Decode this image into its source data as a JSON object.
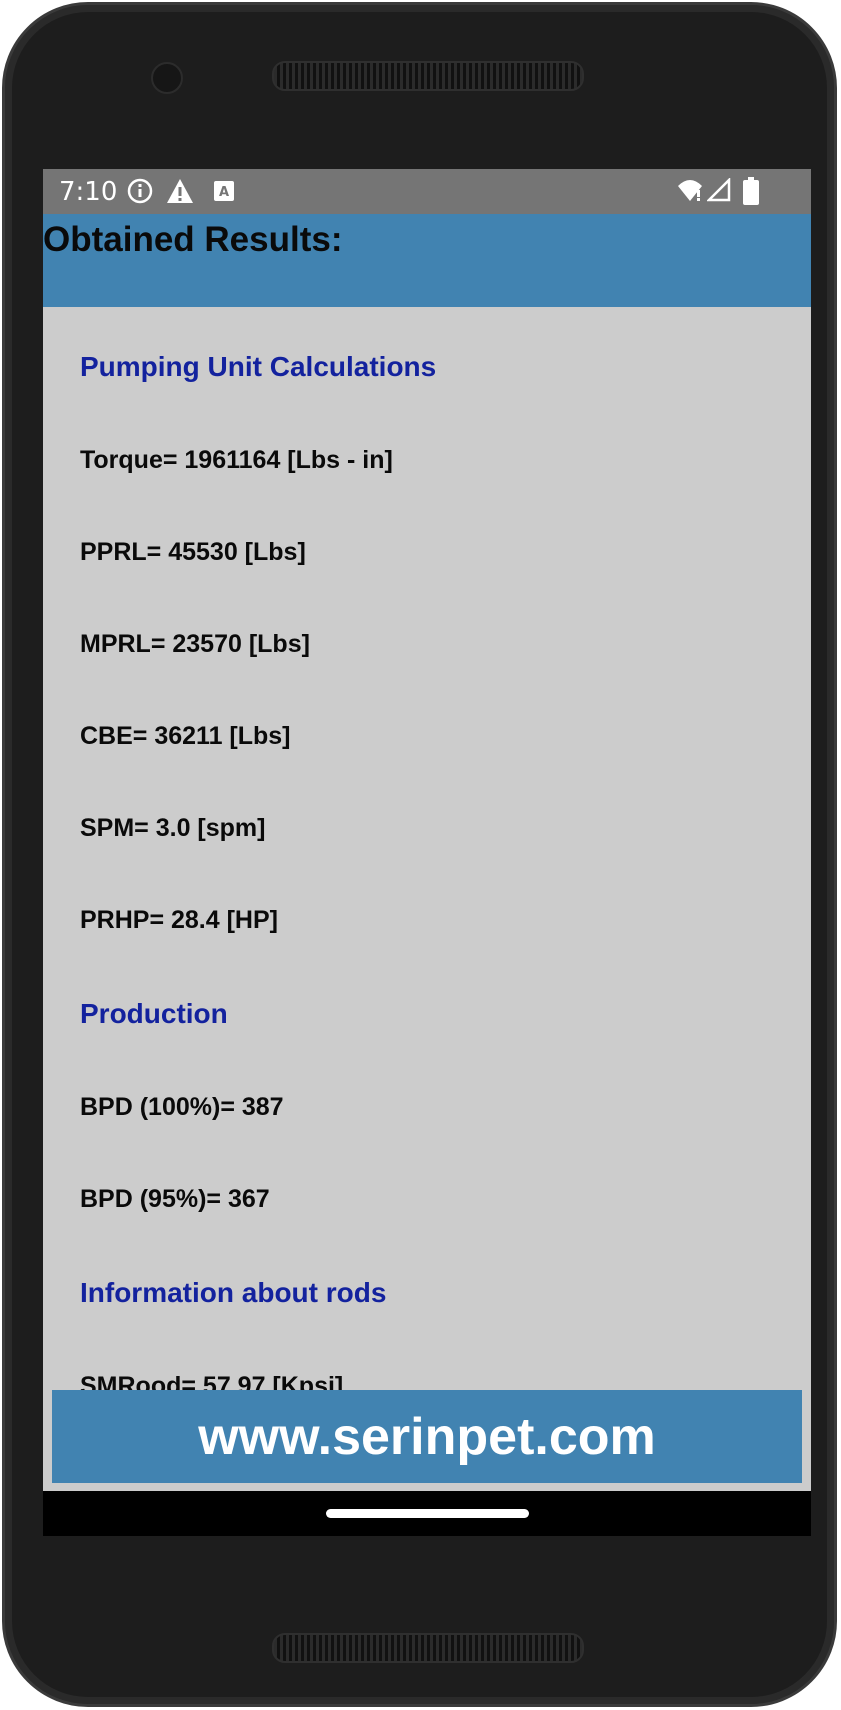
{
  "status_bar": {
    "time": "7:10",
    "icons_left": [
      "info-icon",
      "warning-icon",
      "text-a-icon"
    ],
    "icons_right": [
      "wifi-icon",
      "signal-icon",
      "battery-icon"
    ]
  },
  "app_bar": {
    "title": "Obtained Results:"
  },
  "sections": [
    {
      "heading": "Pumping Unit Calculations",
      "items": [
        "Torque= 1961164 [Lbs - in]",
        "PPRL= 45530 [Lbs]",
        "MPRL= 23570 [Lbs]",
        "CBE= 36211 [Lbs]",
        "SPM= 3.0 [spm]",
        "PRHP= 28.4 [HP]"
      ]
    },
    {
      "heading": "Production",
      "items": [
        "BPD (100%)= 387",
        "BPD (95%)= 367"
      ]
    },
    {
      "heading": "Information about rods",
      "items": [
        "SMRood= 57.97 [Kpsi]"
      ]
    }
  ],
  "banner": {
    "text": "www.serinpet.com"
  },
  "colors": {
    "accent": "#4183b1",
    "heading": "#13229e",
    "background": "#cccccc",
    "status_bar": "#757575"
  }
}
